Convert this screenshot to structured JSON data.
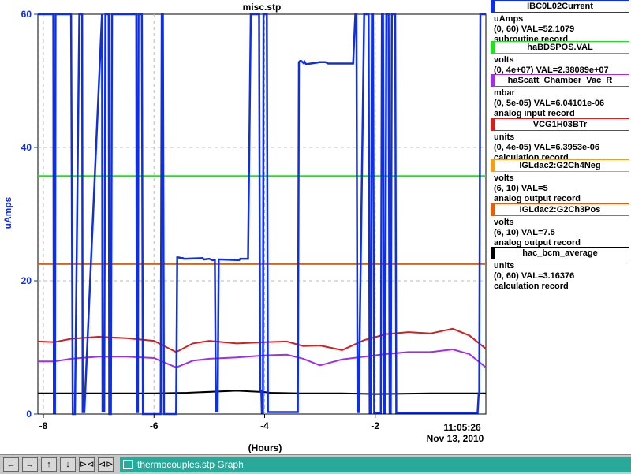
{
  "window": {
    "tab_label": "thermocouples.stp Graph",
    "nav_buttons": [
      "←",
      "→",
      "↑",
      "↓",
      "⊳⊲",
      "⊲⊳"
    ]
  },
  "chart_data": {
    "type": "line",
    "title": "misc.stp",
    "xlabel": "(Hours)",
    "ylabel": "uAmps",
    "xlim": [
      -8.1,
      -0.0
    ],
    "ylim": [
      0,
      60
    ],
    "x_ticks": [
      -8,
      -6,
      -4,
      -2
    ],
    "x_tick_labels": [
      "-8",
      "-6",
      "-4",
      "-2"
    ],
    "y_ticks": [
      0,
      20,
      40,
      60
    ],
    "y_tick_labels": [
      "0",
      "20",
      "40",
      "60"
    ],
    "grid": true,
    "time_label": "11:05:26",
    "date_label": "Nov 13, 2010",
    "legend": [
      {
        "name": "IBC0L02Current",
        "color": "#1030e0",
        "unit": "uAmps",
        "range": "(0, 60) VAL=52.1079",
        "record": "subroutine record"
      },
      {
        "name": "haBDSPOS.VAL",
        "color": "#20e020",
        "unit": "volts",
        "range": "(0, 4e+07) VAL=2.38089e+07",
        "record": ""
      },
      {
        "name": "haScatt_Chamber_Vac_R",
        "color": "#a030e0",
        "unit": "mbar",
        "range": "(0, 5e-05) VAL=6.04101e-06",
        "record": "analog input record"
      },
      {
        "name": "VCG1H03BTr",
        "color": "#d02020",
        "unit": "units",
        "range": "(0, 4e-05) VAL=6.3953e-06",
        "record": "calculation record"
      },
      {
        "name": "IGLdac2:G2Ch4Neg",
        "color": "#f0a020",
        "unit": "volts",
        "range": "(6, 10) VAL=5",
        "record": "analog output record"
      },
      {
        "name": "IGLdac2:G2Ch3Pos",
        "color": "#e06010",
        "unit": "volts",
        "range": "(6, 10) VAL=7.5",
        "record": "analog output record"
      },
      {
        "name": "hac_bcm_average",
        "color": "#000000",
        "unit": "units",
        "range": "(0, 60) VAL=3.16376",
        "record": "calculation record"
      }
    ],
    "series": [
      {
        "name": "haBDSPOS.VAL",
        "color": "#20e020",
        "x": [
          -8.1,
          0.0
        ],
        "y": [
          35.7,
          35.7
        ]
      },
      {
        "name": "IGLdac2:G2Ch3Pos",
        "color": "#e06010",
        "x": [
          -8.1,
          0.0
        ],
        "y": [
          22.5,
          22.5
        ]
      },
      {
        "name": "hac_bcm_average",
        "color": "#000000",
        "x": [
          -8.1,
          -6.0,
          -5.4,
          -4.5,
          -4.0,
          -3.9,
          -3.3,
          -2.6,
          -2.0,
          -1.0,
          0.0
        ],
        "y": [
          3.1,
          3.1,
          3.2,
          3.5,
          3.3,
          3.2,
          3.1,
          3.1,
          3.0,
          3.1,
          3.1
        ]
      },
      {
        "name": "VCG1H03BTr",
        "color": "#d02020",
        "x": [
          -8.1,
          -7.8,
          -7.5,
          -7.0,
          -6.5,
          -6.0,
          -5.6,
          -5.3,
          -5.0,
          -4.5,
          -4.0,
          -3.6,
          -3.3,
          -3.0,
          -2.6,
          -2.2,
          -1.8,
          -1.4,
          -1.0,
          -0.6,
          -0.3,
          0.0
        ],
        "y": [
          10.9,
          10.8,
          11.3,
          11.6,
          11.4,
          11.0,
          9.3,
          10.6,
          11.0,
          10.6,
          10.8,
          10.9,
          10.2,
          10.3,
          9.6,
          11.1,
          12.0,
          12.3,
          12.1,
          12.8,
          11.8,
          9.8
        ]
      },
      {
        "name": "haScatt_Chamber_Vac_R",
        "color": "#a030e0",
        "x": [
          -8.1,
          -7.8,
          -7.5,
          -7.0,
          -6.5,
          -6.0,
          -5.6,
          -5.3,
          -5.0,
          -4.5,
          -4.0,
          -3.6,
          -3.3,
          -3.0,
          -2.6,
          -2.2,
          -1.8,
          -1.4,
          -1.0,
          -0.6,
          -0.3,
          0.0
        ],
        "y": [
          7.9,
          7.9,
          8.3,
          8.6,
          8.6,
          8.4,
          7.0,
          8.0,
          8.3,
          8.5,
          8.8,
          8.9,
          8.3,
          7.3,
          8.2,
          8.6,
          9.0,
          9.3,
          9.3,
          9.7,
          9.0,
          7.0
        ]
      },
      {
        "name": "IBC0L02Current",
        "color": "#1030e0",
        "x": [
          -8.1,
          -7.82,
          -7.81,
          -7.79,
          -7.78,
          -7.5,
          -7.47,
          -7.43,
          -7.35,
          -7.3,
          -7.29,
          -7.26,
          -6.94,
          -6.93,
          -6.9,
          -6.88,
          -6.82,
          -6.81,
          -6.78,
          -6.76,
          -6.32,
          -6.31,
          -6.29,
          -6.28,
          -6.22,
          -6.2,
          -5.88,
          -5.86,
          -5.84,
          -5.82,
          -5.6,
          -5.58,
          -5.56,
          -5.5,
          -5.48,
          -5.46,
          -5.44,
          -5.12,
          -5.1,
          -5.0,
          -4.95,
          -4.9,
          -4.88,
          -4.85,
          -4.83,
          -4.8,
          -4.5,
          -4.46,
          -4.44,
          -4.3,
          -4.25,
          -4.1,
          -4.08,
          -4.06,
          -4.05,
          -4.03,
          -4.02,
          -3.96,
          -3.94,
          -3.4,
          -3.38,
          -3.36,
          -3.34,
          -3.3,
          -3.28,
          -3.25,
          -3.0,
          -2.9,
          -2.85,
          -2.4,
          -2.36,
          -2.34,
          -2.32,
          -2.3,
          -2.2,
          -2.12,
          -2.1,
          -2.08,
          -2.06,
          -2.04,
          -2.02,
          -1.9,
          -1.88,
          -1.86,
          -1.84,
          -1.82,
          -1.8,
          -1.76,
          -1.74,
          -1.72,
          -1.7,
          -1.64,
          -1.62,
          -0.15,
          -0.13,
          -0.12,
          -0.1,
          -0.08,
          0.0
        ],
        "y": [
          60,
          60,
          0.2,
          0.2,
          60,
          60,
          0,
          0,
          60,
          60,
          0.3,
          0.3,
          60,
          0.4,
          0.4,
          60,
          60,
          0,
          0,
          60,
          60,
          0.3,
          0.3,
          60,
          60,
          0,
          0,
          60,
          60,
          0,
          0,
          23.5,
          23.5,
          23.4,
          23.4,
          23.3,
          23.3,
          23.4,
          23.2,
          23.3,
          23.1,
          23.1,
          0.4,
          0.4,
          23.2,
          23.2,
          23.1,
          23.1,
          23.3,
          23.3,
          60,
          60,
          3.5,
          3.5,
          0.2,
          0.2,
          60,
          60,
          0.3,
          0.3,
          52.8,
          53.0,
          53.0,
          52.7,
          52.9,
          52.5,
          52.8,
          52.8,
          52.6,
          52.6,
          60,
          60,
          0.3,
          0.3,
          60,
          60,
          0.2,
          0.2,
          60,
          60,
          0.2,
          0.2,
          60,
          60,
          0.2,
          0.2,
          60,
          60,
          0.2,
          0.2,
          60,
          60,
          0.2,
          0.2,
          3.1,
          3.1,
          60,
          60,
          60
        ]
      }
    ]
  }
}
